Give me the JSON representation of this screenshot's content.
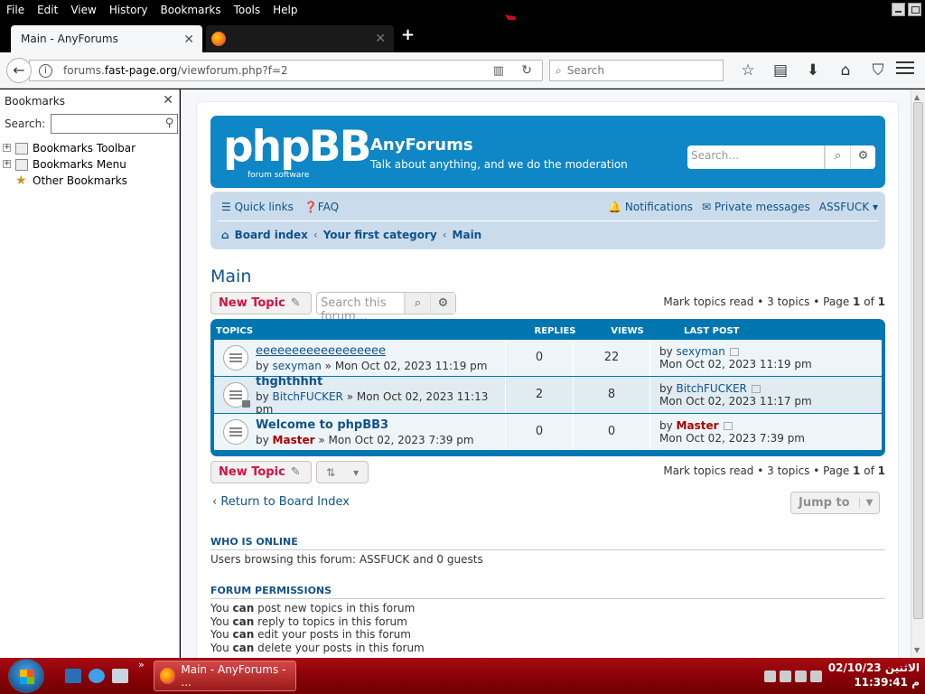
{
  "menubar": {
    "items": [
      "File",
      "Edit",
      "View",
      "History",
      "Bookmarks",
      "Tools",
      "Help"
    ]
  },
  "tabs": [
    {
      "title": "Main - AnyForums"
    }
  ],
  "address": {
    "host": "forums.",
    "domain": "fast-page.org",
    "path": "/viewforum.php?f=2"
  },
  "search": {
    "placeholder": "Search"
  },
  "sidebar": {
    "title": "Bookmarks",
    "search_label": "Search:",
    "items": [
      {
        "label": "Bookmarks Toolbar",
        "expandable": true
      },
      {
        "label": "Bookmarks Menu",
        "expandable": true
      },
      {
        "label": "Other Bookmarks",
        "expandable": false
      }
    ]
  },
  "forum": {
    "logo_text": "phpBB",
    "logo_sub": "forum  software",
    "site_name": "AnyForums",
    "site_desc": "Talk about anything, and we do the moderation",
    "header_search_placeholder": "Search…",
    "nav": {
      "quick_links": "Quick links",
      "faq": "FAQ",
      "notifications": "Notifications",
      "private_messages": "Private messages",
      "username": "ASSFUCK",
      "breadcrumbs": [
        "Board index",
        "Your first category",
        "Main"
      ]
    },
    "title": "Main",
    "new_topic": "New Topic",
    "forum_search_placeholder": "Search this forum…",
    "pagination": {
      "mark_read": "Mark topics read",
      "count": "3 topics",
      "page_label": "Page",
      "page": "1",
      "of": "of",
      "total": "1"
    },
    "columns": {
      "topics": "TOPICS",
      "replies": "REPLIES",
      "views": "VIEWS",
      "last_post": "LAST POST"
    },
    "topics": [
      {
        "title": "eeeeeeeeeeeeeeeeee",
        "by": "by",
        "author": "sexyman",
        "author_red": false,
        "date": "Mon Oct 02, 2023 11:19 pm",
        "replies": "0",
        "views": "22",
        "last_by": "sexyman",
        "last_red": false,
        "last_date": "Mon Oct 02, 2023 11:19 pm",
        "locked": false
      },
      {
        "title": "thghthhht",
        "by": "by",
        "author": "BitchFUCKER",
        "author_red": false,
        "date": "Mon Oct 02, 2023 11:13 pm",
        "replies": "2",
        "views": "8",
        "last_by": "BitchFUCKER",
        "last_red": false,
        "last_date": "Mon Oct 02, 2023 11:17 pm",
        "locked": true
      },
      {
        "title": "Welcome to phpBB3",
        "by": "by",
        "author": "Master",
        "author_red": true,
        "date": "Mon Oct 02, 2023 7:39 pm",
        "replies": "0",
        "views": "0",
        "last_by": "Master",
        "last_red": true,
        "last_date": "Mon Oct 02, 2023 7:39 pm",
        "locked": false
      }
    ],
    "return_link": "Return to Board Index",
    "jump_to": "Jump to",
    "who_online": {
      "heading": "WHO IS ONLINE",
      "text": "Users browsing this forum: ASSFUCK and 0 guests"
    },
    "permissions": {
      "heading": "FORUM PERMISSIONS",
      "lines": [
        {
          "pre": "You ",
          "can": "can",
          "post": " post new topics in this forum"
        },
        {
          "pre": "You ",
          "can": "can",
          "post": " reply to topics in this forum"
        },
        {
          "pre": "You ",
          "can": "can",
          "post": " edit your posts in this forum"
        },
        {
          "pre": "You ",
          "can": "can",
          "post": " delete your posts in this forum"
        }
      ]
    }
  },
  "taskbar": {
    "task_title": "Main - AnyForums - ...",
    "date": "الاثنين 02/10/23",
    "time": "م 11:39:41"
  }
}
